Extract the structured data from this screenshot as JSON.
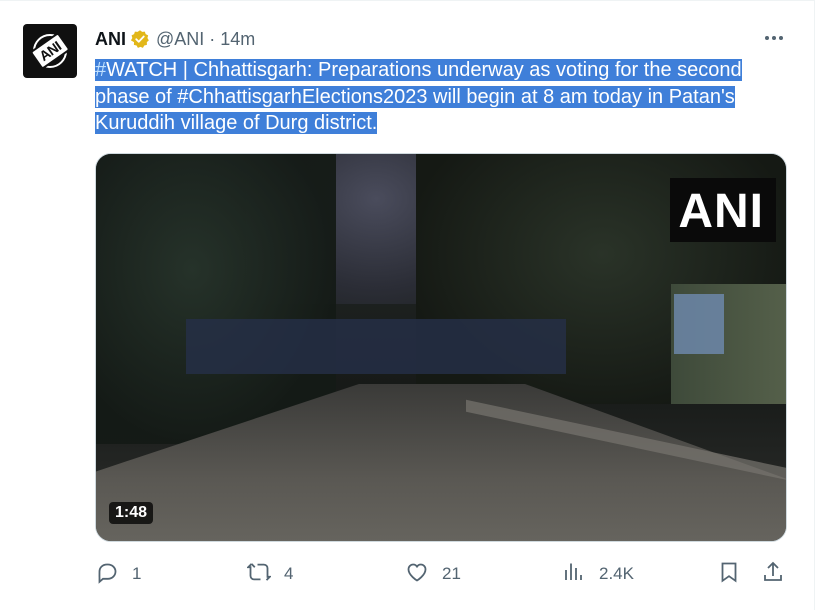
{
  "tweet": {
    "author_name": "ANI",
    "handle": "@ANI",
    "separator": "·",
    "time": "14m",
    "text_parts": {
      "tag1": "#",
      "p1": "WATCH | Chhattisgarh: Preparations underway as voting for the second phase of ",
      "tag2": "#ChhattisgarhElections2023",
      "p2": " will begin at 8 am today in Patan's Kuruddih village of Durg district."
    },
    "media": {
      "watermark": "ANI",
      "duration": "1:48"
    },
    "actions": {
      "replies": "1",
      "reposts": "4",
      "likes": "21",
      "views": "2.4K"
    },
    "icons": {
      "verified": "verified-badge-icon",
      "more": "more-options-icon",
      "reply": "reply-icon",
      "repost": "repost-icon",
      "like": "heart-icon",
      "views": "views-chart-icon",
      "bookmark": "bookmark-icon",
      "share": "share-icon"
    },
    "colors": {
      "highlight": "#3f7fd9",
      "verified_gold": "#e2b719",
      "secondary_text": "#536471"
    }
  }
}
